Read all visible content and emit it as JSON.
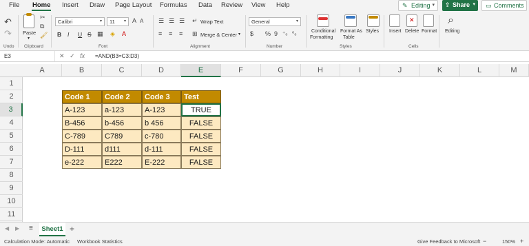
{
  "menu": {
    "tabs": [
      "File",
      "Home",
      "Insert",
      "Draw",
      "Page Layout",
      "Formulas",
      "Data",
      "Review",
      "View",
      "Help"
    ],
    "active": "Home",
    "editing_label": "Editing",
    "share_label": "Share",
    "comments_label": "Comments"
  },
  "ribbon": {
    "undo_label": "Undo",
    "clipboard_label": "Clipboard",
    "paste_label": "Paste",
    "font_name": "Calibri",
    "font_size": "11",
    "font_label": "Font",
    "bold": "B",
    "italic": "I",
    "underline": "U",
    "strike": "S",
    "wrap_text": "Wrap Text",
    "merge_center": "Merge & Center",
    "alignment_label": "Alignment",
    "number_format": "General",
    "number_label": "Number",
    "conditional_formatting": "Conditional",
    "conditional_formatting_2": "Formatting",
    "format_as_table": "Format As",
    "format_as_table_2": "Table",
    "styles_btn": "Styles",
    "styles_label": "Styles",
    "insert_label": "Insert",
    "delete_label": "Delete",
    "format_label": "Format",
    "cells_label": "Cells",
    "editing_grp": "Editing"
  },
  "formula_bar": {
    "name_box": "E3",
    "formula": "=AND(B3=C3:D3)"
  },
  "grid": {
    "columns": [
      "A",
      "B",
      "C",
      "D",
      "E",
      "F",
      "G",
      "H",
      "I",
      "J",
      "K",
      "L",
      "M"
    ],
    "rows": [
      "1",
      "2",
      "3",
      "4",
      "5",
      "6",
      "7",
      "8",
      "9",
      "10",
      "11"
    ],
    "selected_column": "E",
    "selected_row": "3",
    "table_headers": [
      "Code 1",
      "Code 2",
      "Code 3",
      "Test"
    ],
    "table_rows": [
      [
        "A-123",
        "a-123",
        "A-123",
        "TRUE"
      ],
      [
        "B-456",
        "b-456",
        "b 456",
        "FALSE"
      ],
      [
        "C-789",
        "C789",
        "c-780",
        "FALSE"
      ],
      [
        "D-111",
        "d111",
        "d-111",
        "FALSE"
      ],
      [
        "e-222",
        "E222",
        "E-222",
        "FALSE"
      ]
    ]
  },
  "sheets": {
    "tabs": [
      "Sheet1"
    ],
    "add": "+"
  },
  "status": {
    "calc_mode": "Calculation Mode: Automatic",
    "workbook_stats": "Workbook Statistics",
    "feedback": "Give Feedback to Microsoft",
    "zoom": "150%",
    "zoom_minus": "−",
    "zoom_plus": "+"
  },
  "colors": {
    "accent": "#217346",
    "table_header": "#c28a00",
    "table_fill": "#fde9c1"
  }
}
